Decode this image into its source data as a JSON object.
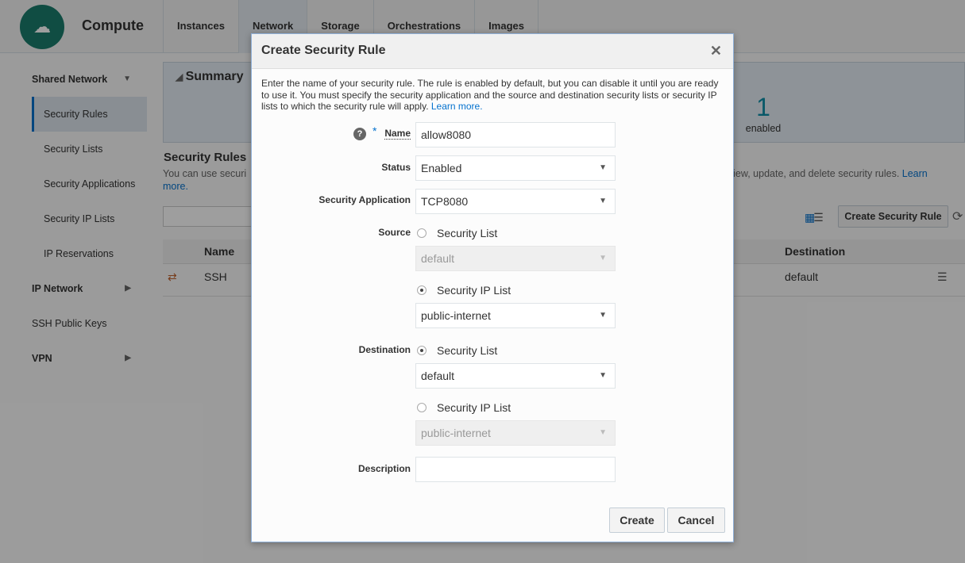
{
  "app": {
    "title": "Compute",
    "logo_icon": "cloud-server-icon"
  },
  "tabs": [
    {
      "label": "Instances"
    },
    {
      "label": "Network",
      "selected": true
    },
    {
      "label": "Storage"
    },
    {
      "label": "Orchestrations"
    },
    {
      "label": "Images"
    }
  ],
  "sidebar": {
    "items": [
      {
        "label": "Shared Network"
      },
      {
        "label": "Security Rules"
      },
      {
        "label": "Security Lists"
      },
      {
        "label": "Security Applications"
      },
      {
        "label": "Security IP Lists"
      },
      {
        "label": "IP Reservations"
      },
      {
        "label": "IP Network"
      },
      {
        "label": "SSH Public Keys"
      },
      {
        "label": "VPN"
      }
    ]
  },
  "summary": {
    "title": "Summary",
    "count": "1",
    "count_label": "enabled"
  },
  "section": {
    "title": "Security Rules",
    "desc_start": "You can use securi",
    "desc_end": "e, view, update, and delete security rules. ",
    "learn": "Learn",
    "more": "more."
  },
  "toolbar": {
    "create_label": "Create Security Rule"
  },
  "table": {
    "headers": [
      "Name",
      "Destination"
    ],
    "rows": [
      {
        "name": "SSH",
        "destination": "default"
      }
    ]
  },
  "dialog": {
    "title": "Create Security Rule",
    "intro": "Enter the name of your security rule. The rule is enabled by default, but you can disable it until you are ready to use it. You must specify the security application and the source and destination security lists or security IP lists to which the security rule will apply. ",
    "learn_more": "Learn more.",
    "name_label": "Name",
    "name_value": "allow8080",
    "status_label": "Status",
    "status_value": "Enabled",
    "app_label": "Security Application",
    "app_value": "TCP8080",
    "source_label": "Source",
    "source_list_label": "Security List",
    "source_list_value": "default",
    "source_ip_label": "Security IP List",
    "source_ip_value": "public-internet",
    "dest_label": "Destination",
    "dest_list_label": "Security List",
    "dest_list_value": "default",
    "dest_ip_label": "Security IP List",
    "dest_ip_value": "public-internet",
    "description_label": "Description",
    "description_value": "",
    "create": "Create",
    "cancel": "Cancel"
  },
  "colors": {
    "accent": "#0572ce",
    "logo": "#1a7d6c"
  }
}
